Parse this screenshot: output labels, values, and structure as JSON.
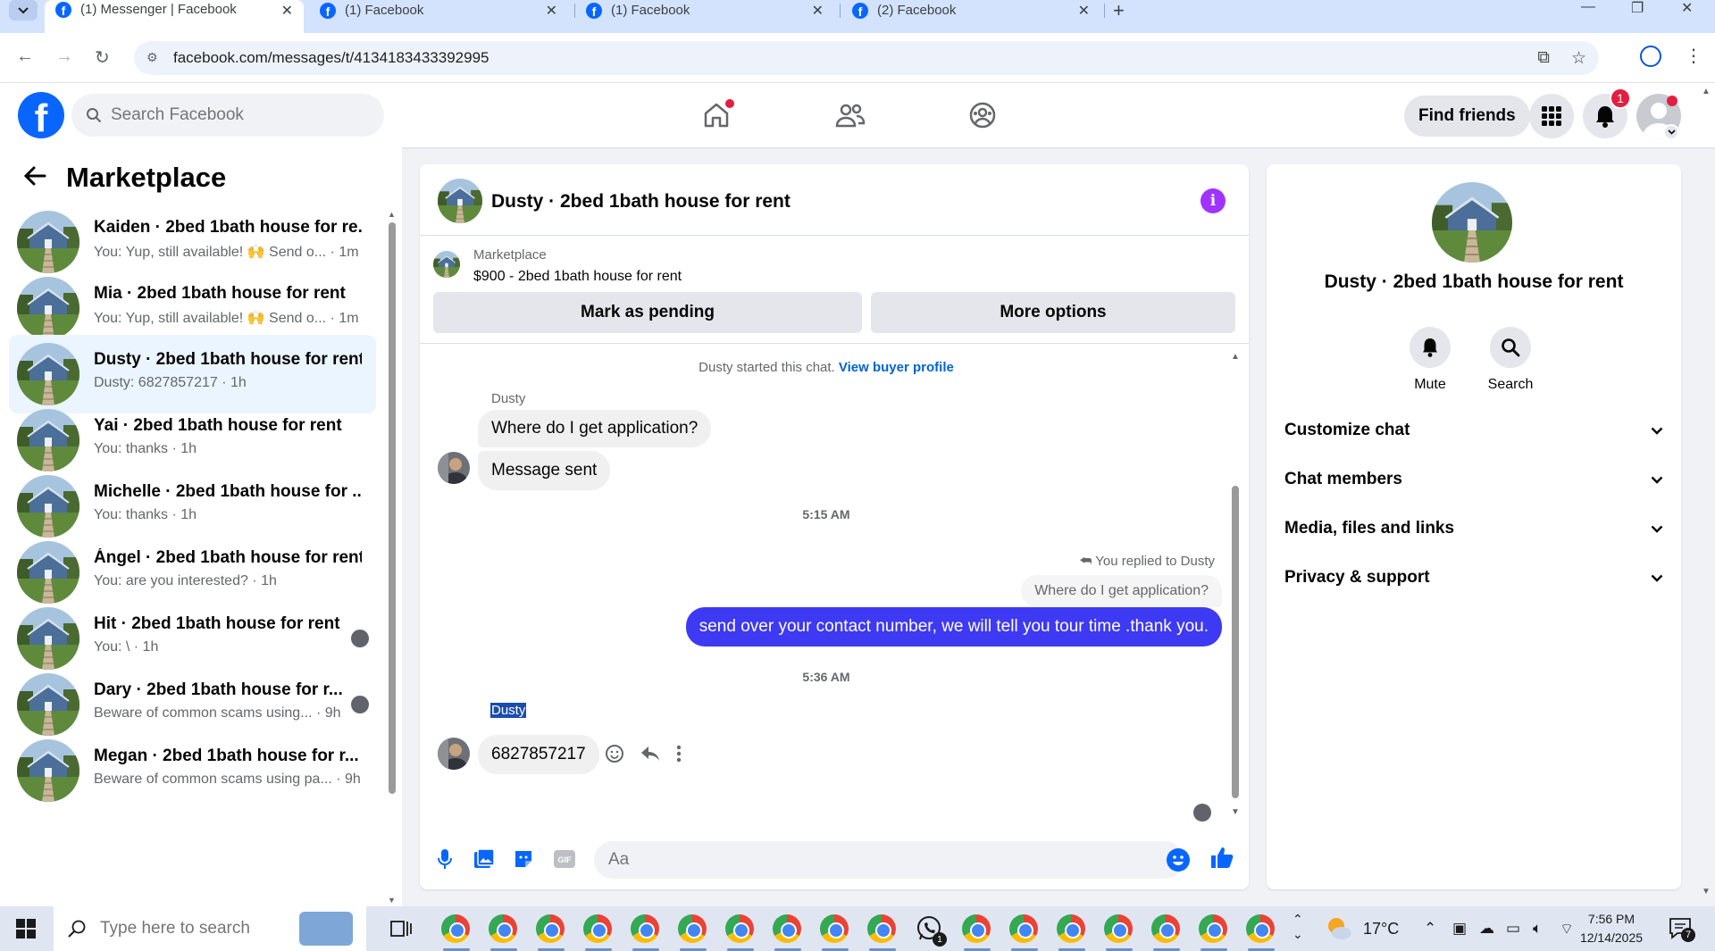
{
  "browser": {
    "tabs": [
      {
        "title": "(1) Messenger | Facebook",
        "active": true
      },
      {
        "title": "(1) Facebook",
        "active": false
      },
      {
        "title": "(1) Facebook",
        "active": false
      },
      {
        "title": "(2) Facebook",
        "active": false
      }
    ],
    "url": "facebook.com/messages/t/4134183433392995"
  },
  "header": {
    "search_placeholder": "Search Facebook",
    "find_friends": "Find friends",
    "notification_count": "1"
  },
  "sidebar": {
    "title": "Marketplace",
    "conversations": [
      {
        "name": "Kaiden · 2bed 1bath house for re...",
        "preview": "You: Yup, still available! 🙌 Send o... · 1m"
      },
      {
        "name": "Mia · 2bed 1bath house for rent",
        "preview": "You: Yup, still available! 🙌 Send o... · 1m"
      },
      {
        "name": "Dusty · 2bed 1bath house for rent",
        "preview": "Dusty: 6827857217 · 1h"
      },
      {
        "name": "Yai · 2bed 1bath house for rent",
        "preview": "You: thanks · 1h"
      },
      {
        "name": "Michelle · 2bed 1bath house for ...",
        "preview": "You: thanks · 1h"
      },
      {
        "name": "Ángel · 2bed 1bath house for rent",
        "preview": "You: are you interested? · 1h"
      },
      {
        "name": "Hit · 2bed 1bath house for rent",
        "preview": "You: \\ · 1h"
      },
      {
        "name": "Dary · 2bed 1bath house for r...",
        "preview": "Beware of common scams using... · 9h"
      },
      {
        "name": "Megan · 2bed 1bath house for r...",
        "preview": "Beware of common scams using pa... · 9h"
      }
    ]
  },
  "chat": {
    "title": "Dusty · 2bed 1bath house for rent",
    "marketplace_label": "Marketplace",
    "listing": "$900 - 2bed 1bath house for rent",
    "mark_pending": "Mark as pending",
    "more_options": "More options",
    "started_text": "Dusty started this chat.",
    "view_profile": "View buyer profile",
    "sender1": "Dusty",
    "msg1": "Where do I get application?",
    "msg2": "Message sent",
    "time1": "5:15 AM",
    "replied_to": "You replied to Dusty",
    "quoted": "Where do I get application?",
    "reply": "send over your contact number, we will tell you tour time .thank you.",
    "time2": "5:36 AM",
    "sender2": "Dusty",
    "msg3": "6827857217",
    "composer_placeholder": "Aa"
  },
  "details": {
    "name": "Dusty · 2bed 1bath house for rent",
    "mute": "Mute",
    "search": "Search",
    "sections": [
      "Customize chat",
      "Chat members",
      "Media, files and links",
      "Privacy & support"
    ]
  },
  "taskbar": {
    "search_placeholder": "Type here to search",
    "temperature": "17°C",
    "time": "7:56 PM",
    "date": "12/14/2025",
    "whatsapp_badge": "1",
    "notif_count": "7"
  },
  "colors": {
    "fb_blue": "#0866ff",
    "outgoing_bubble": "#3e39f2",
    "info_purple": "#a033ff",
    "selected_row": "#ebf5ff"
  }
}
